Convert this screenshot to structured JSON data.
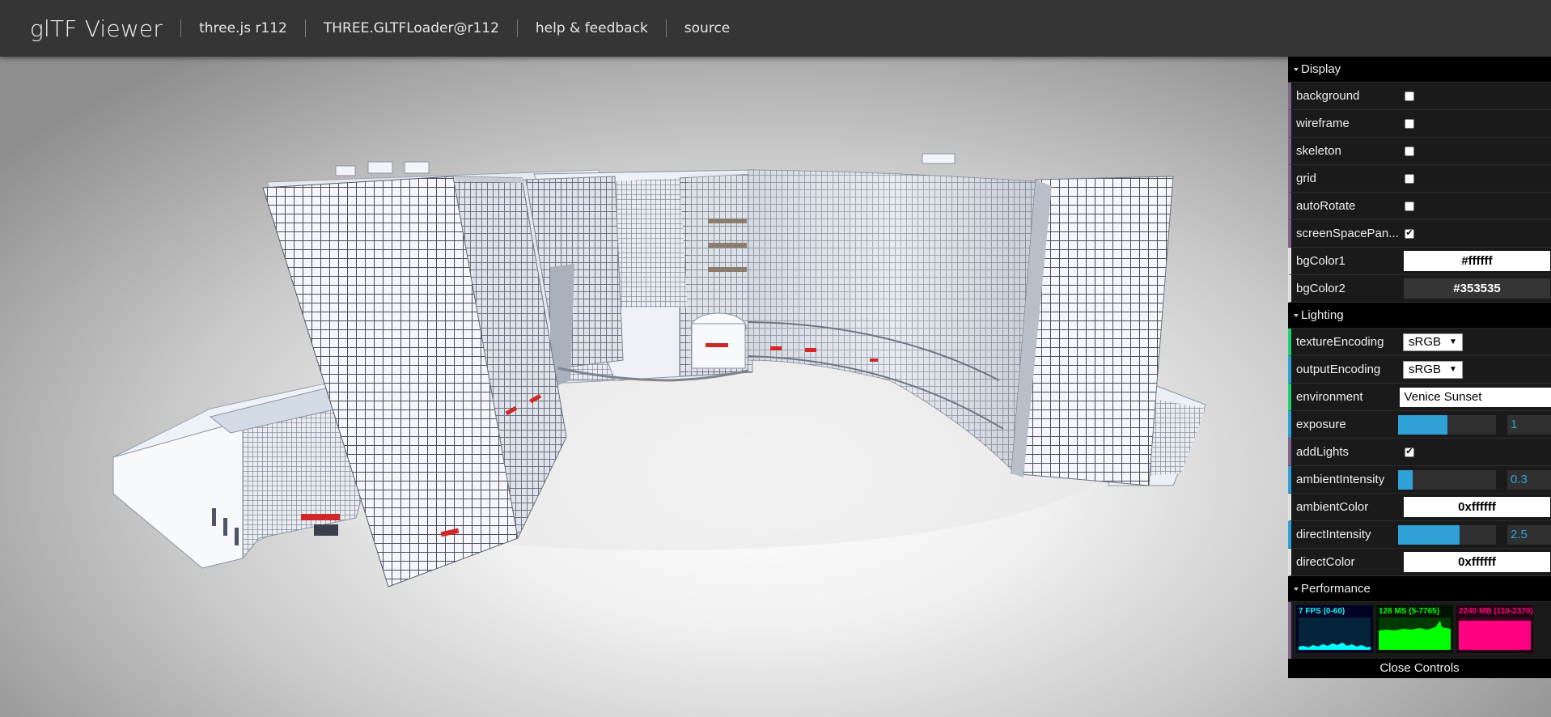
{
  "header": {
    "title": "glTF Viewer",
    "links": [
      "three.js r112",
      "THREE.GLTFLoader@r112",
      "help & feedback",
      "source"
    ]
  },
  "viewer": {
    "background_gradient": [
      "#ffffff",
      "#353535"
    ]
  },
  "gui": {
    "display": {
      "title": "Display",
      "background_label": "background",
      "background_checked": false,
      "wireframe_label": "wireframe",
      "wireframe_checked": false,
      "skeleton_label": "skeleton",
      "skeleton_checked": false,
      "grid_label": "grid",
      "grid_checked": false,
      "autorotate_label": "autoRotate",
      "autorotate_checked": false,
      "screenspacepan_label": "screenSpacePan...",
      "screenspacepan_checked": true,
      "bgcolor1_label": "bgColor1",
      "bgcolor1_value": "#ffffff",
      "bgcolor2_label": "bgColor2",
      "bgcolor2_value": "#353535"
    },
    "lighting": {
      "title": "Lighting",
      "textureencoding_label": "textureEncoding",
      "textureencoding_value": "sRGB",
      "outputencoding_label": "outputEncoding",
      "outputencoding_value": "sRGB",
      "environment_label": "environment",
      "environment_value": "Venice Sunset",
      "exposure_label": "exposure",
      "exposure_value": "1",
      "exposure_fraction": 0.5,
      "addlights_label": "addLights",
      "addlights_checked": true,
      "ambientintensity_label": "ambientIntensity",
      "ambientintensity_value": "0.3",
      "ambientintensity_fraction": 0.15,
      "ambientcolor_label": "ambientColor",
      "ambientcolor_value": "0xffffff",
      "directintensity_label": "directIntensity",
      "directintensity_value": "2.5",
      "directintensity_fraction": 0.625,
      "directcolor_label": "directColor",
      "directcolor_value": "0xffffff"
    },
    "performance": {
      "title": "Performance",
      "fps_text": "7 FPS (0-60)",
      "ms_text": "128 MS (5-7765)",
      "mb_text": "2240 MB (110-2370)"
    },
    "close_label": "Close Controls"
  },
  "colors": {
    "accent_number": "#2fa1d6",
    "accent_boolean": "#806787",
    "accent_select": "#1ed36f",
    "fps": "#00ffff",
    "ms": "#00ff00",
    "mb": "#ff0080"
  }
}
